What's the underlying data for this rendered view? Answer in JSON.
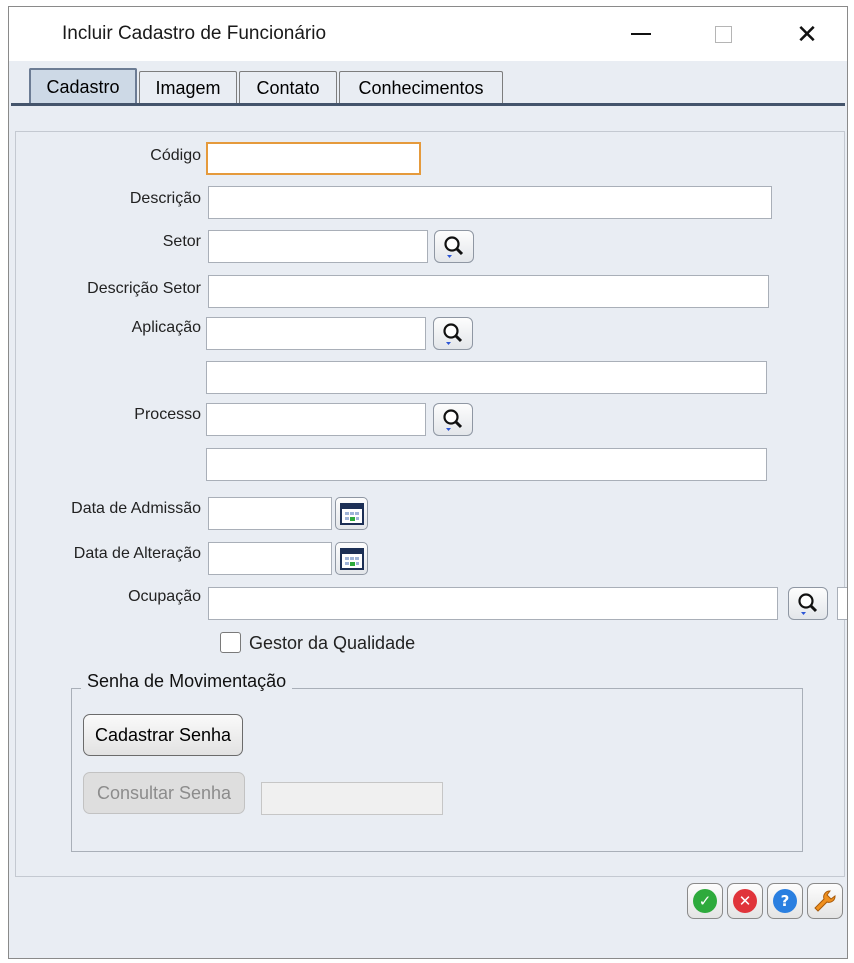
{
  "window": {
    "title": "Incluir Cadastro de Funcionário"
  },
  "tabs": [
    {
      "label": "Cadastro",
      "active": true
    },
    {
      "label": "Imagem",
      "active": false
    },
    {
      "label": "Contato",
      "active": false
    },
    {
      "label": "Conhecimentos",
      "active": false
    }
  ],
  "form": {
    "codigo": {
      "label": "Código",
      "value": ""
    },
    "descricao": {
      "label": "Descrição",
      "value": ""
    },
    "setor": {
      "label": "Setor",
      "value": ""
    },
    "descricao_setor": {
      "label": "Descrição Setor",
      "value": ""
    },
    "aplicacao": {
      "label": "Aplicação",
      "value": "",
      "description": ""
    },
    "processo": {
      "label": "Processo",
      "value": "",
      "description": ""
    },
    "data_admissao": {
      "label": "Data de Admissão",
      "value": ""
    },
    "data_alteracao": {
      "label": "Data de Alteração",
      "value": ""
    },
    "ocupacao": {
      "label": "Ocupação",
      "value": ""
    },
    "gestor_qualidade": {
      "label": "Gestor da Qualidade",
      "checked": false
    }
  },
  "senha": {
    "group_title": "Senha de Movimentação",
    "cadastrar_label": "Cadastrar Senha",
    "consultar_label": "Consultar Senha",
    "consultar_value": ""
  },
  "actions": [
    {
      "name": "confirm",
      "icon": "check-icon",
      "color": "#2eaa3c"
    },
    {
      "name": "cancel",
      "icon": "x-icon",
      "color": "#e0343a"
    },
    {
      "name": "help",
      "icon": "question-icon",
      "color": "#2a7fe0"
    },
    {
      "name": "settings",
      "icon": "wrench-icon",
      "color": "#f0901e"
    }
  ]
}
